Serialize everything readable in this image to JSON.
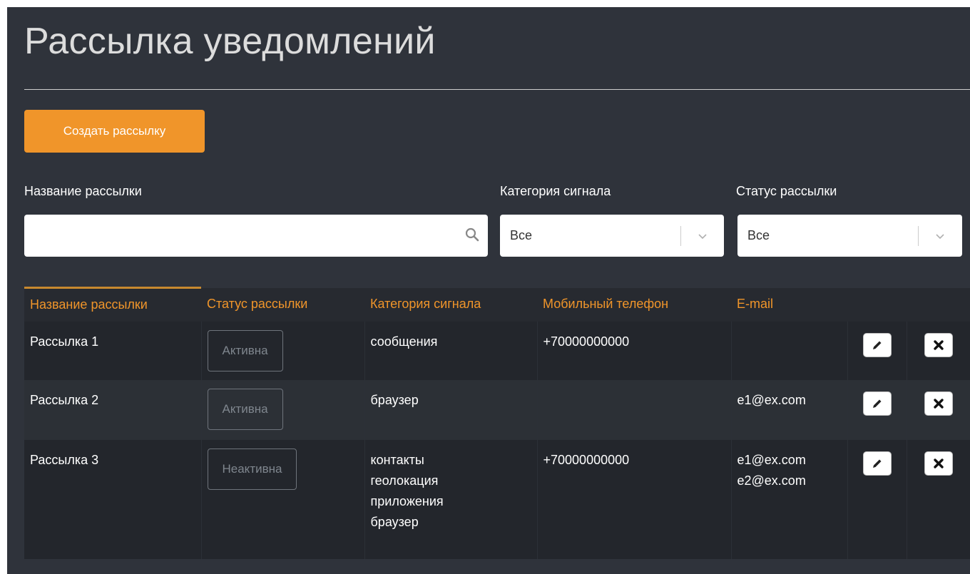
{
  "page": {
    "title": "Рассылка уведомлений",
    "create_button": "Создать рассылку"
  },
  "filters": {
    "name_label": "Название рассылки",
    "name_value": "",
    "category_label": "Категория сигнала",
    "category_value": "Все",
    "status_label": "Статус рассылки",
    "status_value": "Все"
  },
  "table": {
    "columns": [
      "Название рассылки",
      "Статус рассылки",
      "Категория сигнала",
      "Мобильный телефон",
      "E-mail"
    ],
    "rows": [
      {
        "name": "Рассылка 1",
        "status": "Активна",
        "categories": [
          "сообщения"
        ],
        "phone": "+70000000000",
        "emails": []
      },
      {
        "name": "Рассылка 2",
        "status": "Активна",
        "categories": [
          "браузер"
        ],
        "phone": "",
        "emails": [
          "e1@ex.com"
        ]
      },
      {
        "name": "Рассылка 3",
        "status": "Неактивна",
        "categories": [
          "контакты",
          "геолокация",
          "приложения",
          "браузер"
        ],
        "phone": "+70000000000",
        "emails": [
          "e1@ex.com",
          "e2@ex.com"
        ]
      }
    ]
  },
  "icons": {
    "search": "search-icon",
    "dropdown": "chevron-down-icon",
    "edit": "pencil-icon",
    "delete": "close-icon"
  },
  "colors": {
    "accent": "#f0952a",
    "background": "#2f333b",
    "row_dark": "#23262c",
    "row_light": "#2c3036"
  }
}
